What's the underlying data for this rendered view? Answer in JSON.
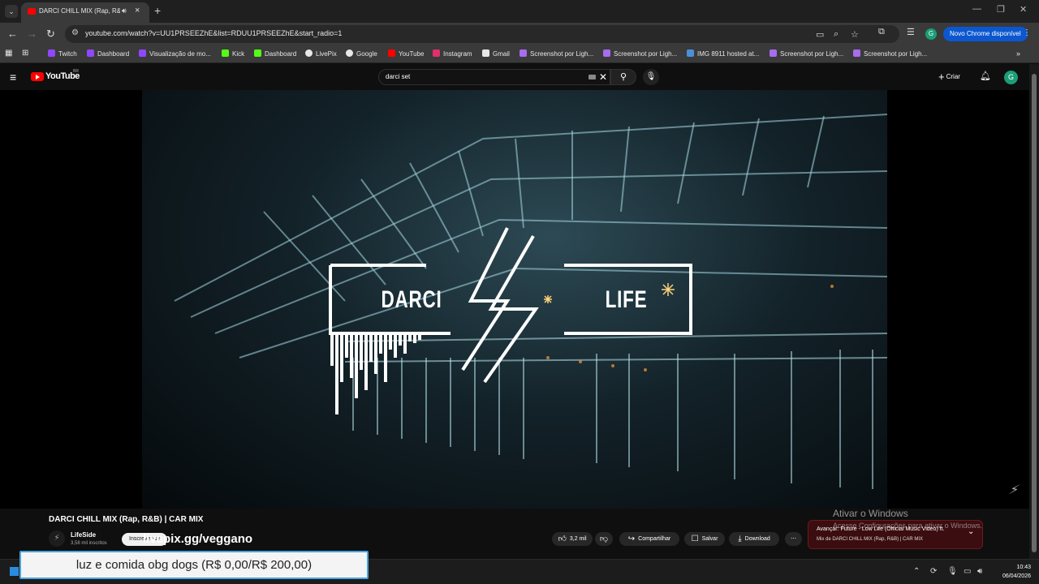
{
  "browser": {
    "tab_title": "DARCI CHILL MIX (Rap, R&B)",
    "url": "youtube.com/watch?v=UU1PRSEEZhE&list=RDUU1PRSEEZhE&start_radio=1",
    "update_button": "Novo Chrome disponível",
    "profile_letter": "G"
  },
  "bookmarks": [
    {
      "label": "Twitch",
      "color": "#9146ff"
    },
    {
      "label": "Dashboard",
      "color": "#9146ff"
    },
    {
      "label": "Visualização de mo...",
      "color": "#9146ff"
    },
    {
      "label": "Kick",
      "color": "#53fc18"
    },
    {
      "label": "Dashboard",
      "color": "#53fc18"
    },
    {
      "label": "LivePix",
      "color": "#e8e8e8"
    },
    {
      "label": "Google",
      "color": "#e8e8e8"
    },
    {
      "label": "YouTube",
      "color": "#ff0000"
    },
    {
      "label": "Instagram",
      "color": "#e1306c"
    },
    {
      "label": "Gmail",
      "color": "#e8e8e8"
    },
    {
      "label": "Screenshot por Ligh...",
      "color": "#a86cf0"
    },
    {
      "label": "Screenshot por Ligh...",
      "color": "#a86cf0"
    },
    {
      "label": "IMG 8911 hosted at...",
      "color": "#4a90d9"
    },
    {
      "label": "Screenshot por Ligh...",
      "color": "#a86cf0"
    },
    {
      "label": "Screenshot por Ligh...",
      "color": "#a86cf0"
    }
  ],
  "youtube": {
    "logo_text": "YouTube",
    "country": "BR",
    "search_query": "darci set",
    "create_label": "Criar",
    "avatar_letter": "G"
  },
  "video": {
    "overlay_left": "DARCI",
    "overlay_right": "LIFE",
    "title": "DARCI CHILL MIX (Rap, R&B) | CAR MIX",
    "channel_name": "LifeSide",
    "channel_subs": "3,58 mil inscritos",
    "subscribe_label": "Inscrever-se",
    "likes": "3,2 mil",
    "share_label": "Compartilhar",
    "save_label": "Salvar",
    "download_label": "Download"
  },
  "overlay": {
    "stream_link": "livepix.gg/veggano",
    "goal_text": "luz e comida obg dogs (R$ 0,00/R$ 200,00)"
  },
  "up_next": {
    "title": "Avançar: Future - Low Life (Official Music Video) ft.",
    "subtitle": "Mix de DARCI CHILL MIX (Rap, R&B) | CAR MIX"
  },
  "windows": {
    "watermark_title": "Ativar o Windows",
    "watermark_sub": "Acesse Configurações para ativar o Windows.",
    "time": "10:43",
    "date": "06/04/2026"
  }
}
